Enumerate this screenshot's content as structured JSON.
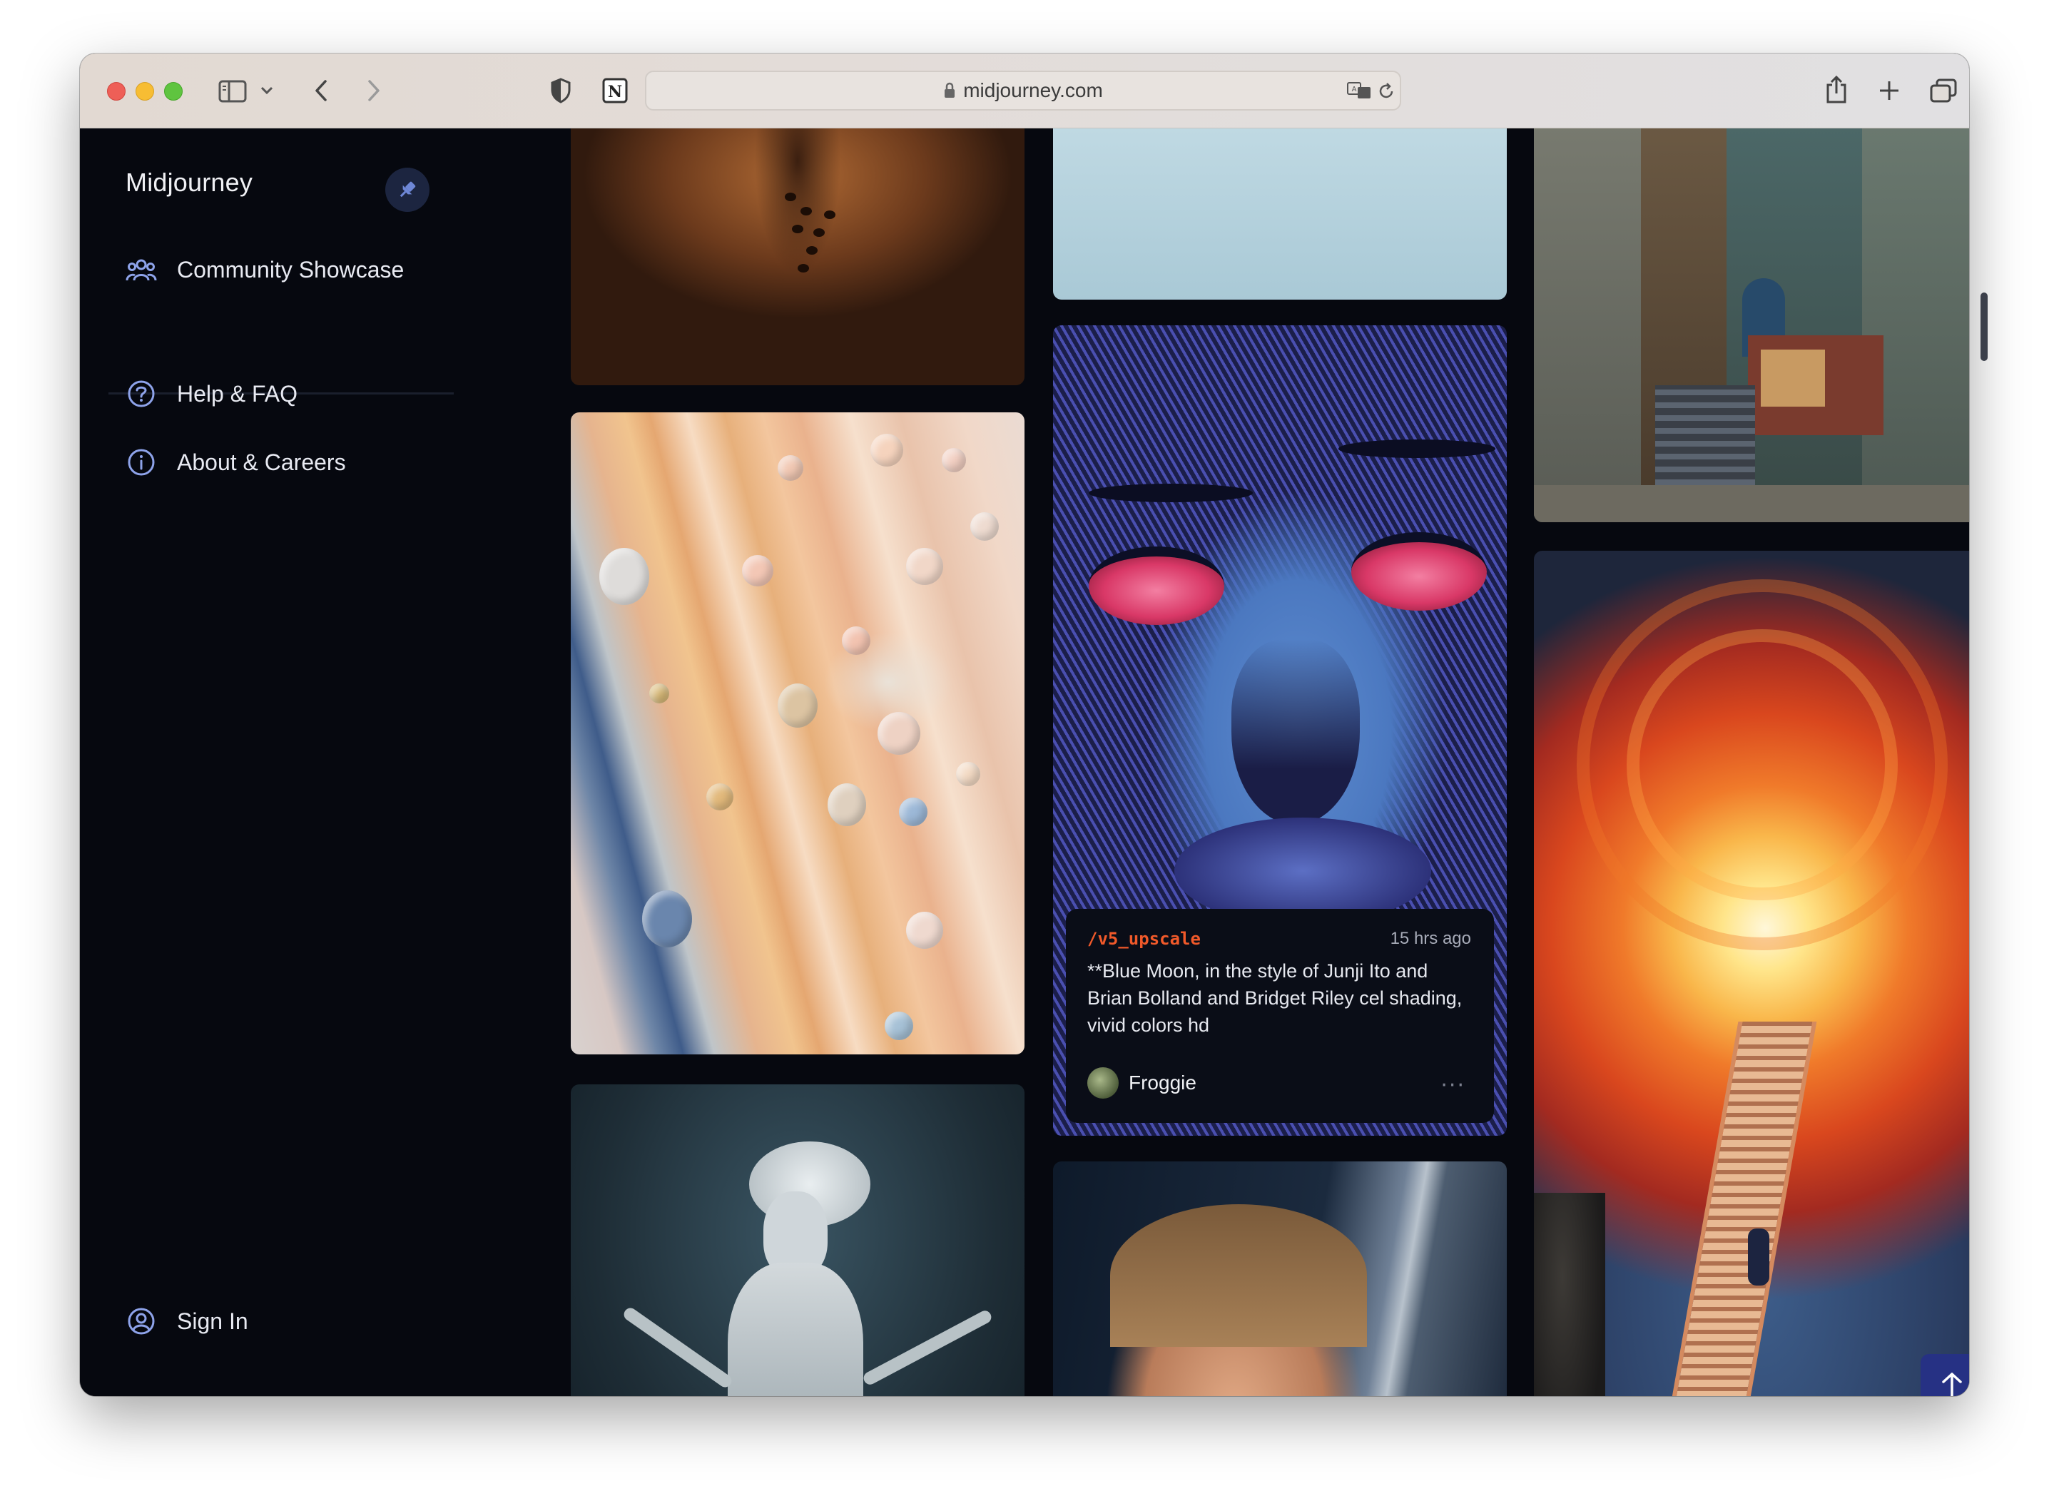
{
  "browser": {
    "url": "midjourney.com",
    "icons": [
      "sidebar-toggle-icon",
      "chevron-down-icon",
      "back-icon",
      "forward-icon",
      "privacy-shield-icon",
      "notion-icon",
      "lock-icon",
      "translate-icon",
      "reload-icon",
      "share-icon",
      "new-tab-icon",
      "tab-overview-icon"
    ]
  },
  "sidebar": {
    "brand": "Midjourney",
    "pin_icon": "pin-icon",
    "primary_items": [
      {
        "label": "Community Showcase",
        "icon": "community-icon"
      }
    ],
    "secondary_items": [
      {
        "label": "Help & FAQ",
        "icon": "help-icon"
      },
      {
        "label": "About & Careers",
        "icon": "info-icon"
      }
    ],
    "sign_in": {
      "label": "Sign In",
      "icon": "user-circle-icon"
    }
  },
  "feed": {
    "hover_card": {
      "command": "/v5_upscale",
      "time": "15 hrs ago",
      "prompt": "**Blue Moon, in the style of Junji Ito and Brian Bolland and Bridget Riley cel shading, vivid colors hd",
      "user": "Froggie",
      "more": "···"
    },
    "scroll_top_icon": "arrow-up-icon"
  },
  "colors": {
    "background": "#06080f",
    "accent": "#263184",
    "command": "#f0592a"
  }
}
